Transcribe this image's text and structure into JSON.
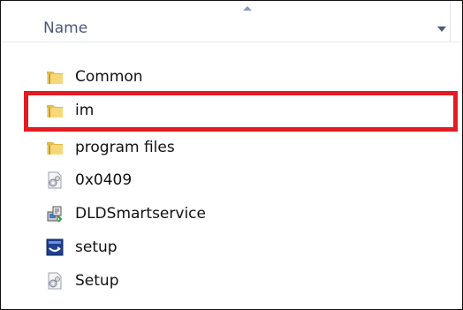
{
  "column_header": {
    "label": "Name",
    "sort_icon": "sort-ascending-icon",
    "dropdown_icon": "chevron-down-icon"
  },
  "files": [
    {
      "name": "Common",
      "icon": "folder-icon"
    },
    {
      "name": "im",
      "icon": "folder-icon",
      "highlighted": true
    },
    {
      "name": "program files",
      "icon": "folder-icon"
    },
    {
      "name": "0x0409",
      "icon": "settings-file-icon"
    },
    {
      "name": "DLDSmartservice",
      "icon": "installer-icon"
    },
    {
      "name": "setup",
      "icon": "setup-app-icon"
    },
    {
      "name": "Setup",
      "icon": "settings-file-icon"
    }
  ],
  "colors": {
    "highlight": "#e31b23",
    "header_text": "#49587a",
    "folder": "#e8c45c"
  }
}
